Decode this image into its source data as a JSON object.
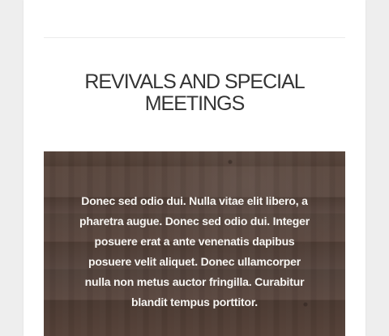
{
  "section": {
    "title_lines": [
      "REVIVALS AND SPECIAL",
      "MEETINGS"
    ]
  },
  "feature": {
    "text_lines": [
      "Donec sed odio dui. Nulla vitae elit libero, a",
      "pharetra augue. Donec sed odio dui. Integer",
      "posuere erat a ante venenatis dapibus",
      "posuere velit aliquet. Donec ullamcorper",
      "nulla non metus auctor fringilla. Curabitur",
      "blandit tempus porttitor."
    ]
  },
  "colors": {
    "page_background": "#eeeeee",
    "card_background": "#ffffff",
    "title_text": "#343434",
    "feature_background": "#56443b",
    "feature_text": "#f7f5f2"
  }
}
